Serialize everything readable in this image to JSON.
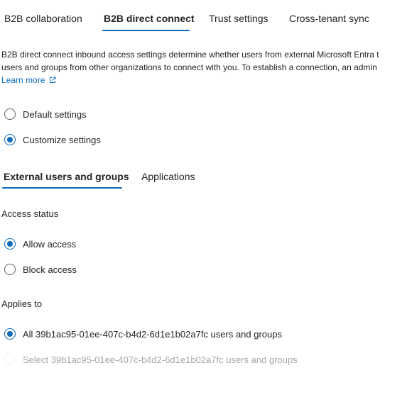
{
  "top_tabs": {
    "b2b_collaboration": "B2B collaboration",
    "b2b_direct_connect": "B2B direct connect",
    "trust_settings": "Trust settings",
    "cross_tenant_sync": "Cross-tenant sync",
    "selected": "B2B direct connect"
  },
  "description": {
    "line1": "B2B direct connect inbound access settings determine whether users from external Microsoft Entra t",
    "line2": "users and groups from other organizations to connect with you. To establish a connection, an admin",
    "learn_more": "Learn more",
    "learn_more_icon": "external-link-icon"
  },
  "settings_mode": {
    "default_label": "Default settings",
    "customize_label": "Customize settings",
    "selected": "Customize settings"
  },
  "inner_tabs": {
    "external_users_groups": "External users and groups",
    "applications": "Applications",
    "selected": "External users and groups"
  },
  "access_status": {
    "label": "Access status",
    "allow_label": "Allow access",
    "block_label": "Block access",
    "selected": "Allow access"
  },
  "applies_to": {
    "label": "Applies to",
    "all_label": "All 39b1ac95-01ee-407c-b4d2-6d1e1b02a7fc users and groups",
    "select_label": "Select 39b1ac95-01ee-407c-b4d2-6d1e1b02a7fc users and groups",
    "selected": "All 39b1ac95-01ee-407c-b4d2-6d1e1b02a7fc users and groups",
    "select_disabled": true
  },
  "colors": {
    "accent": "#0f6cbd",
    "text": "#242424",
    "disabled_text": "#a6a6a6"
  }
}
